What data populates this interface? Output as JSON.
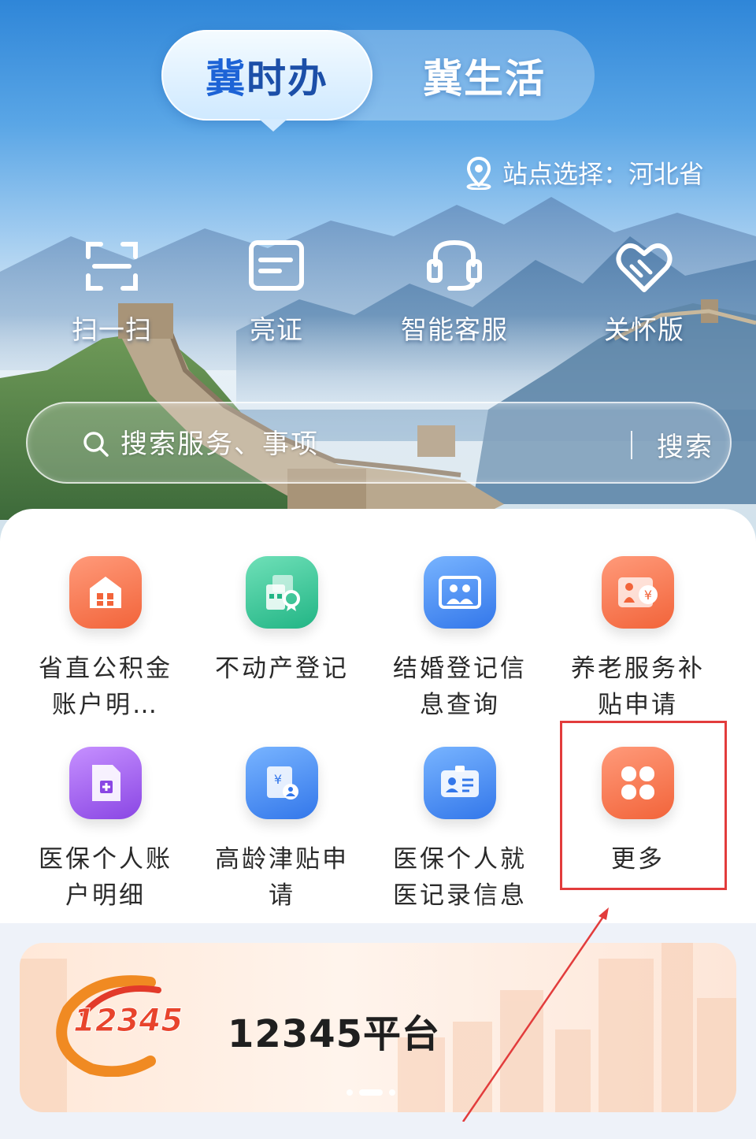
{
  "tabs": {
    "active_first_char": "冀",
    "active_rest": "时办",
    "inactive": "冀生活"
  },
  "location": {
    "text": "站点选择：河北省"
  },
  "quick_actions": [
    {
      "label": "扫一扫",
      "icon": "scan-icon"
    },
    {
      "label": "亮证",
      "icon": "id-card-icon"
    },
    {
      "label": "智能客服",
      "icon": "headset-icon"
    },
    {
      "label": "关怀版",
      "icon": "heart-hands-icon"
    }
  ],
  "search": {
    "placeholder": "搜索服务、事项",
    "button": "搜索"
  },
  "services": [
    {
      "label": "省直公积金账户明…",
      "icon": "house-fund-icon",
      "color": "#f2643a"
    },
    {
      "label": "不动产登记",
      "icon": "property-register-icon",
      "color": "#22b585"
    },
    {
      "label": "结婚登记信息查询",
      "icon": "marriage-photo-icon",
      "color": "#3377ea"
    },
    {
      "label": "养老服务补贴申请",
      "icon": "elderly-subsidy-icon",
      "color": "#f2643a"
    },
    {
      "label": "医保个人账户明细",
      "icon": "medical-account-icon",
      "color": "#8a46e4"
    },
    {
      "label": "高龄津贴申请",
      "icon": "senior-allowance-icon",
      "color": "#3377ea"
    },
    {
      "label": "医保个人就医记录信息",
      "icon": "medical-record-icon",
      "color": "#3377ea"
    },
    {
      "label": "更多",
      "icon": "more-grid-icon",
      "color": "#f2643a"
    }
  ],
  "banner": {
    "logo_text": "12345",
    "title": "12345平台"
  },
  "colors": {
    "annotation_red": "#e23c3c",
    "primary_blue": "#1d63d6"
  }
}
